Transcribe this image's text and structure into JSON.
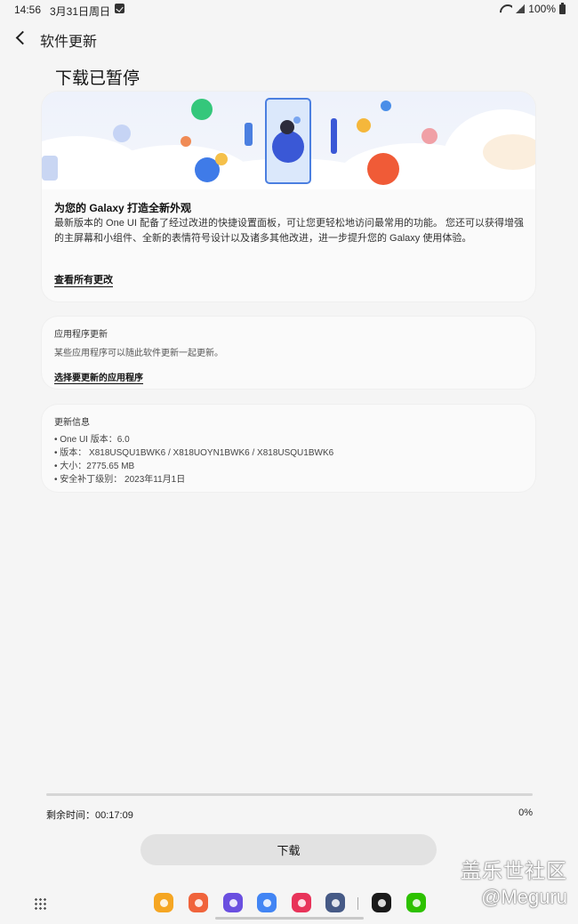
{
  "status_bar": {
    "time": "14:56",
    "date": "3月31日周日",
    "battery": "100%"
  },
  "header": {
    "title": "软件更新"
  },
  "page_title": "下载已暂停",
  "feature_card": {
    "heading": "为您的 Galaxy 打造全新外观",
    "body": "最新版本的 One UI 配备了经过改进的快捷设置面板，可让您更轻松地访问最常用的功能。 您还可以获得增强的主屏幕和小组件、全新的表情符号设计以及诸多其他改进，进一步提升您的 Galaxy 使用体验。",
    "link": "查看所有更改"
  },
  "app_update_card": {
    "heading": "应用程序更新",
    "body": "某些应用程序可以随此软件更新一起更新。",
    "link": "选择要更新的应用程序"
  },
  "update_info_card": {
    "heading": "更新信息",
    "items": [
      "• One UI 版本：6.0",
      "• 版本：  X818USQU1BWK6 / X818UOYN1BWK6 / X818USQU1BWK6",
      "• 大小：2775.65 MB",
      "• 安全补丁级别：  2023年11月1日"
    ]
  },
  "progress": {
    "remaining": "剩余时间：00:17:09",
    "percent": "0%",
    "value": 0
  },
  "download_button": "下载",
  "watermark": {
    "line1": "盖乐世社区",
    "line2": "@Meguru"
  },
  "dock": {
    "apps": [
      {
        "name": "my-files-app",
        "color": "#f5a623"
      },
      {
        "name": "contacts-app",
        "color": "#f0643c"
      },
      {
        "name": "samsung-internet-app",
        "color": "#6a4fe0"
      },
      {
        "name": "chrome-app",
        "color": "#4285f4"
      },
      {
        "name": "screen-recorder-app",
        "color": "#e8345a"
      },
      {
        "name": "settings-app",
        "color": "#465a86"
      },
      {
        "name": "qq-app",
        "color": "#1a1a1a"
      },
      {
        "name": "wechat-app",
        "color": "#2dc100"
      }
    ]
  }
}
